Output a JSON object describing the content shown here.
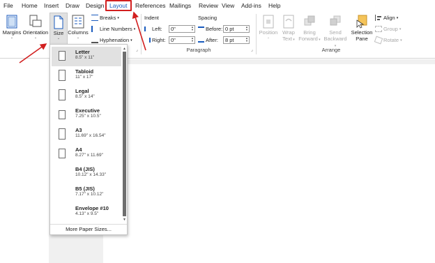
{
  "menubar": {
    "tabs": [
      "File",
      "Home",
      "Insert",
      "Draw",
      "Design",
      "Layout",
      "References",
      "Mailings",
      "Review",
      "View",
      "Add-ins",
      "Help"
    ],
    "active": "Layout"
  },
  "page_setup": {
    "margins": "Margins",
    "orientation": "Orientation",
    "size": "Size",
    "columns": "Columns",
    "breaks": "Breaks",
    "line_numbers": "Line Numbers",
    "hyphenation": "Hyphenation"
  },
  "paragraph": {
    "indent_label": "Indent",
    "spacing_label": "Spacing",
    "left_label": "Left:",
    "right_label": "Right:",
    "before_label": "Before:",
    "after_label": "After:",
    "left_value": "0\"",
    "right_value": "0\"",
    "before_value": "0 pt",
    "after_value": "8 pt",
    "group_label": "Paragraph"
  },
  "arrange": {
    "position": "Position",
    "wrap_text_1": "Wrap",
    "wrap_text_2": "Text",
    "bring_forward_1": "Bring",
    "bring_forward_2": "Forward",
    "send_backward_1": "Send",
    "send_backward_2": "Backward",
    "selection_pane_1": "Selection",
    "selection_pane_2": "Pane",
    "align": "Align",
    "group": "Group",
    "rotate": "Rotate",
    "group_label": "Arrange"
  },
  "size_menu": {
    "items": [
      {
        "title": "Letter",
        "size": "8.5\" x 11\"",
        "selected": true
      },
      {
        "title": "Tabloid",
        "size": "11\" x 17\""
      },
      {
        "title": "Legal",
        "size": "8.5\" x 14\""
      },
      {
        "title": "Executive",
        "size": "7.25\" x 10.5\""
      },
      {
        "title": "A3",
        "size": "11.69\" x 16.54\""
      },
      {
        "title": "A4",
        "size": "8.27\" x 11.69\""
      },
      {
        "title": "B4 (JIS)",
        "size": "10.12\" x 14.33\""
      },
      {
        "title": "B5 (JIS)",
        "size": "7.17\" x 10.12\""
      },
      {
        "title": "Envelope #10",
        "size": "4.13\" x 9.5\""
      }
    ],
    "more": "More Paper Sizes..."
  },
  "colors": {
    "accent": "#185abd",
    "highlight": "#d21f1f"
  }
}
